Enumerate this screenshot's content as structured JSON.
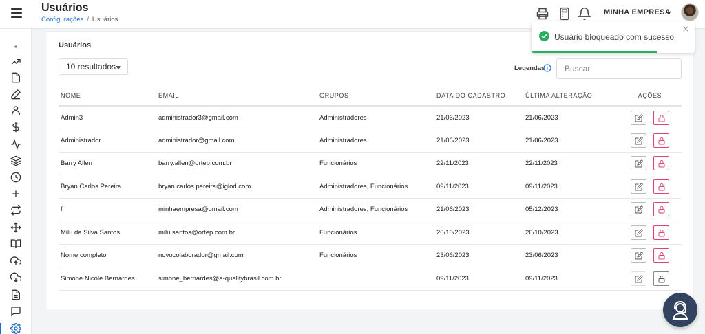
{
  "header": {
    "title": "Usuários",
    "breadcrumb": {
      "parent": "Configurações",
      "separator": "/",
      "current": "Usuários"
    },
    "company": "MINHA EMPRESA"
  },
  "card": {
    "title": "Usuários",
    "per_page": "10 resultados",
    "legend_label": "Legendas",
    "search_placeholder": "Buscar"
  },
  "table": {
    "columns": [
      "NOME",
      "EMAIL",
      "GRUPOS",
      "DATA DO CADASTRO",
      "ÚLTIMA ALTERAÇÃO",
      "AÇÕES"
    ],
    "rows": [
      {
        "name": "Admin3",
        "email": "administrador3@gmail.com",
        "groups": "Administradores",
        "created": "21/06/2023",
        "updated": "21/06/2023",
        "blocked": false
      },
      {
        "name": "Administrador",
        "email": "administrador@gmail.com",
        "groups": "Administradores",
        "created": "21/06/2023",
        "updated": "21/06/2023",
        "blocked": false
      },
      {
        "name": "Barry Allen",
        "email": "barry.allen@ortep.com.br",
        "groups": "Funcionários",
        "created": "22/11/2023",
        "updated": "22/11/2023",
        "blocked": false
      },
      {
        "name": "Bryan Carlos Pereira",
        "email": "bryan.carlos.pereira@iglod.com",
        "groups": "Administradores, Funcionários",
        "created": "09/11/2023",
        "updated": "09/11/2023",
        "blocked": false
      },
      {
        "name": "f",
        "email": "minhaempresa@gmail.com",
        "groups": "Administradores, Funcionários",
        "created": "21/06/2023",
        "updated": "05/12/2023",
        "blocked": false
      },
      {
        "name": "Milu da Silva Santos",
        "email": "milu.santos@ortep.com.br",
        "groups": "Funcionários",
        "created": "26/10/2023",
        "updated": "26/10/2023",
        "blocked": false
      },
      {
        "name": "Nome completo",
        "email": "novocolaborador@gmail.com",
        "groups": "Funcionários",
        "created": "23/06/2023",
        "updated": "23/06/2023",
        "blocked": false
      },
      {
        "name": "Simone Nicole Bernardes",
        "email": "simone_bernardes@a-qualitybrasil.com.br",
        "groups": "",
        "created": "09/11/2023",
        "updated": "09/11/2023",
        "blocked": true
      }
    ]
  },
  "toast": {
    "message": "Usuário bloqueado com sucesso",
    "progress_pct": 77
  },
  "colors": {
    "accent": "#1f6fd1",
    "danger": "#e0466d",
    "success": "#27ae60",
    "chat": "#33435f"
  },
  "icons": {
    "sidebar": [
      "dot-icon",
      "trending-up-icon",
      "file-icon",
      "pen-icon",
      "user-icon",
      "dollar-icon",
      "activity-icon",
      "layers-icon",
      "clock-icon",
      "plus-icon",
      "repeat-icon",
      "move-icon",
      "book-icon",
      "upload-cloud-icon",
      "download-cloud-icon",
      "document-icon",
      "message-icon",
      "settings-icon"
    ],
    "header": [
      "printer-icon",
      "calculator-icon",
      "bell-icon",
      "chevron-down-icon"
    ]
  }
}
